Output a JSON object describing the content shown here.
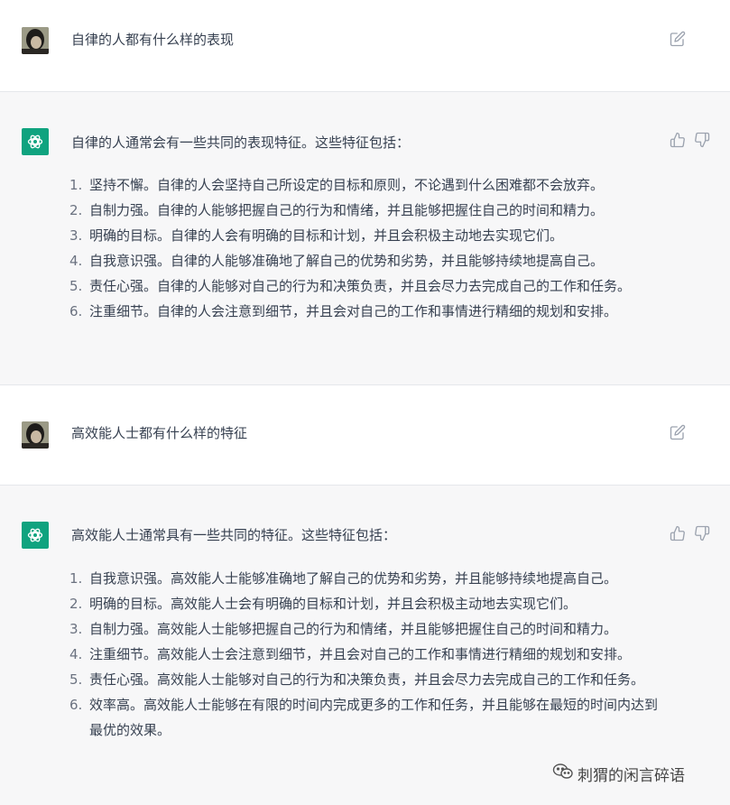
{
  "conversation": [
    {
      "role": "user",
      "text": "自律的人都有什么样的表现"
    },
    {
      "role": "assistant",
      "intro": "自律的人通常会有一些共同的表现特征。这些特征包括：",
      "items": [
        {
          "num": "1.",
          "text": "坚持不懈。自律的人会坚持自己所设定的目标和原则，不论遇到什么困难都不会放弃。"
        },
        {
          "num": "2.",
          "text": "自制力强。自律的人能够把握自己的行为和情绪，并且能够把握住自己的时间和精力。"
        },
        {
          "num": "3.",
          "text": "明确的目标。自律的人会有明确的目标和计划，并且会积极主动地去实现它们。"
        },
        {
          "num": "4.",
          "text": "自我意识强。自律的人能够准确地了解自己的优势和劣势，并且能够持续地提高自己。"
        },
        {
          "num": "5.",
          "text": "责任心强。自律的人能够对自己的行为和决策负责，并且会尽力去完成自己的工作和任务。"
        },
        {
          "num": "6.",
          "text": "注重细节。自律的人会注意到细节，并且会对自己的工作和事情进行精细的规划和安排。"
        }
      ]
    },
    {
      "role": "user",
      "text": "高效能人士都有什么样的特征"
    },
    {
      "role": "assistant",
      "intro": "高效能人士通常具有一些共同的特征。这些特征包括：",
      "items": [
        {
          "num": "1.",
          "text": "自我意识强。高效能人士能够准确地了解自己的优势和劣势，并且能够持续地提高自己。"
        },
        {
          "num": "2.",
          "text": "明确的目标。高效能人士会有明确的目标和计划，并且会积极主动地去实现它们。"
        },
        {
          "num": "3.",
          "text": "自制力强。高效能人士能够把握自己的行为和情绪，并且能够把握住自己的时间和精力。"
        },
        {
          "num": "4.",
          "text": "注重细节。高效能人士会注意到细节，并且会对自己的工作和事情进行精细的规划和安排。"
        },
        {
          "num": "5.",
          "text": "责任心强。高效能人士能够对自己的行为和决策负责，并且会尽力去完成自己的工作和任务。"
        },
        {
          "num": "6.",
          "text": "效率高。高效能人士能够在有限的时间内完成更多的工作和任务，并且能够在最短的时间内达到最优的效果。"
        }
      ]
    }
  ],
  "icons": {
    "edit": "edit-icon",
    "thumbs_up": "thumbs-up-icon",
    "thumbs_down": "thumbs-down-icon",
    "bot_logo": "openai-logo-icon",
    "watermark_logo": "wechat-logo-icon"
  },
  "watermark": {
    "text": "刺猬的闲言碎语"
  },
  "colors": {
    "bot_avatar_bg": "#10a37f",
    "bot_block_bg": "#f7f7f8",
    "text": "#374151"
  }
}
